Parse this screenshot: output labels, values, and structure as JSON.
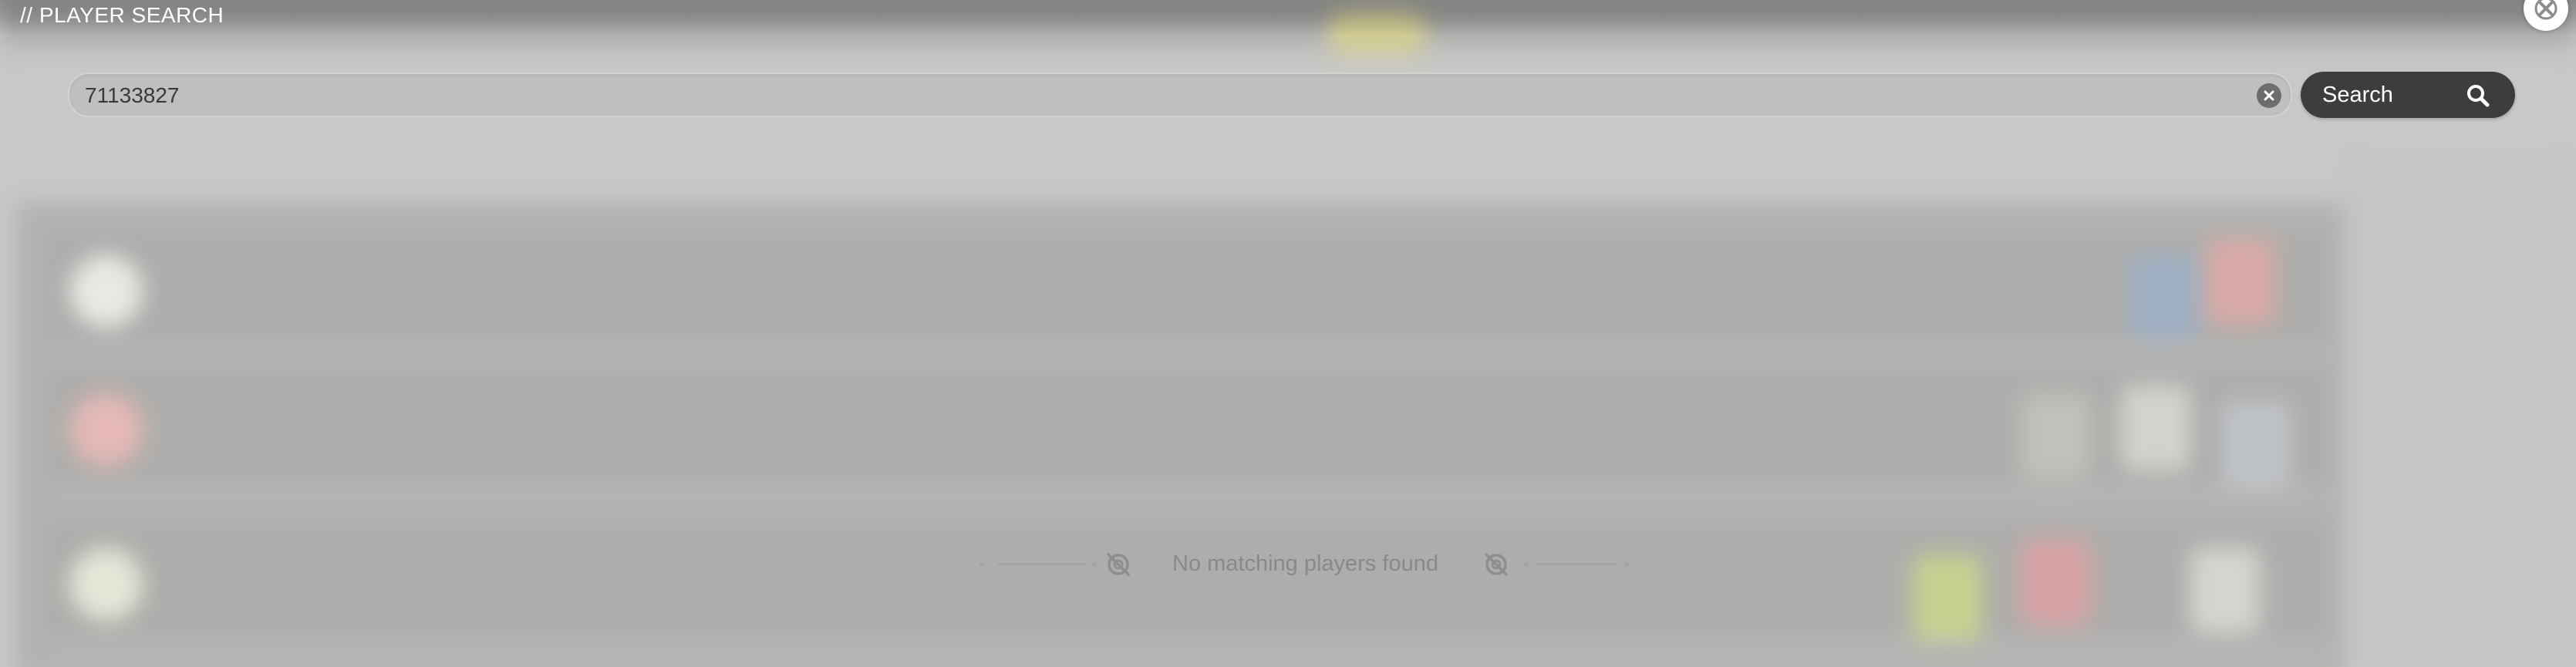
{
  "header": {
    "title": "// PLAYER SEARCH"
  },
  "search": {
    "value": "71133827",
    "button_label": "Search"
  },
  "results": {
    "empty_message": "No matching players found"
  },
  "icons": {
    "close": "close-icon",
    "clear": "clear-icon",
    "search": "search-icon",
    "no_results": "ban-icon"
  }
}
